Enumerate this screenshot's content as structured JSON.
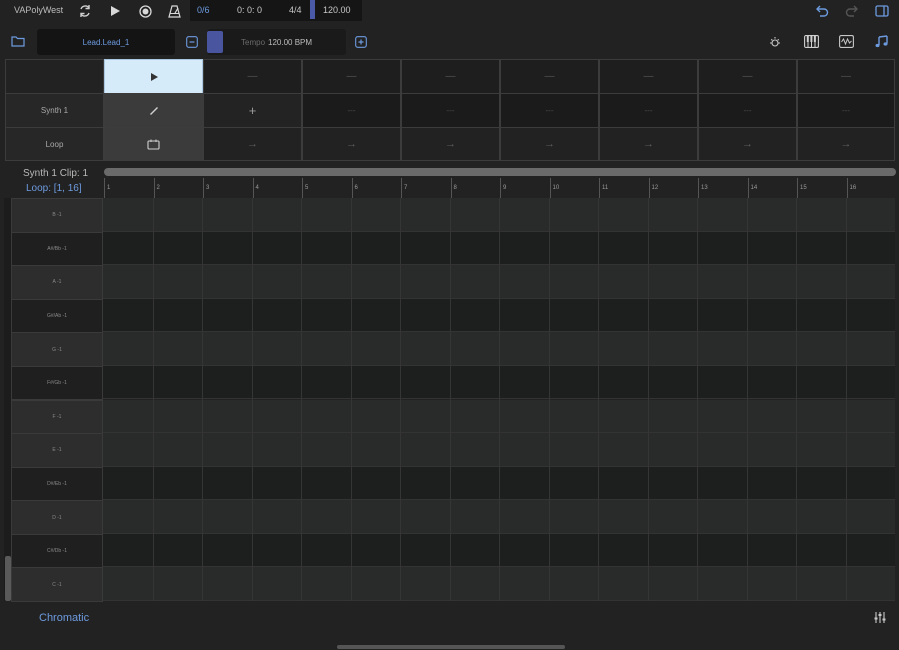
{
  "app": {
    "title": "VAPolyWest"
  },
  "transport": {
    "counter": "0/6",
    "time": "0: 0: 0",
    "meter": "4/4",
    "tempo": "120.00"
  },
  "preset": {
    "name": "Lead.Lead_1"
  },
  "tempo": {
    "label": "Tempo",
    "value": "120.00 BPM"
  },
  "session": {
    "row_labels": [
      "Synth 1",
      "Loop"
    ],
    "scene_symbol": "—",
    "clip_empty": "---",
    "add_symbol": "+",
    "loop_arrow": "→"
  },
  "piano_roll": {
    "clip_title": "Synth 1 Clip: 1",
    "loop_range": "Loop: [1, 16]",
    "beats": [
      "1",
      "2",
      "3",
      "4",
      "5",
      "6",
      "7",
      "8",
      "9",
      "10",
      "11",
      "12",
      "13",
      "14",
      "15",
      "16"
    ],
    "keys": [
      "B -1",
      "A#/Bb -1",
      "A -1",
      "G#/Ab -1",
      "G -1",
      "F#/Gb -1",
      "F -1",
      "E -1",
      "D#/Eb -1",
      "D -1",
      "C#/Db -1",
      "C -1"
    ]
  },
  "bottom": {
    "scale": "Chromatic"
  },
  "colors": {
    "accent": "#6d9be0",
    "selected_cell": "#d6ebfa",
    "tempo_slider": "#4a55a0"
  }
}
